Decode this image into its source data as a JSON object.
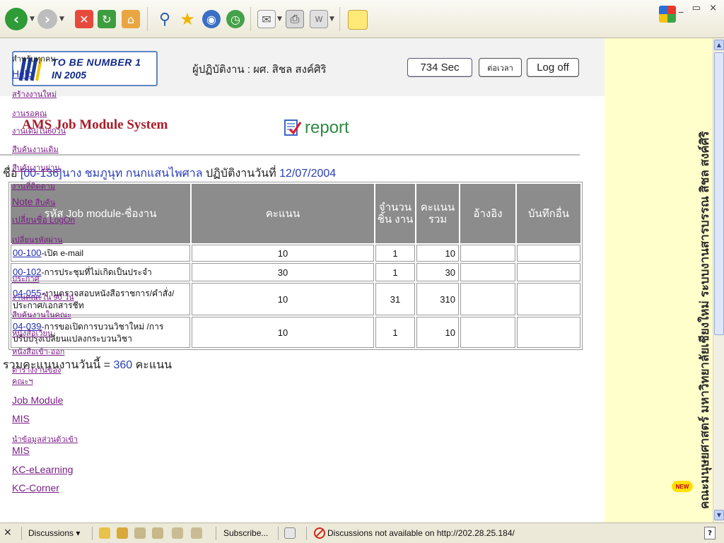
{
  "window": {
    "controls": "_ ▭ ×"
  },
  "header": {
    "logo_line1": "TO BE NUMBER 1",
    "logo_line2": "IN 2005",
    "operator_text": "ผู้ปฏิบัติงาน : ผศ. สิชล สงค์ศิริ",
    "timer_label": "734 Sec",
    "extend_label": "ต่อเวลา",
    "logoff_label": "Log off"
  },
  "main": {
    "system_title": "AMS Job Module System",
    "report_label": "report",
    "person_prefix": "ชื่อ ",
    "person_id_name": "[00-136]นาง ชมภูนุท กนกแสนไพศาล",
    "date_prefix": " ปฏิบัติงานวันที่ ",
    "date": "12/07/2004",
    "table": {
      "headers": {
        "job": "รหัส Job module-ชื่องาน",
        "score": "คะแนน",
        "count": "จำนวน ชิ้น งาน",
        "total": "คะแนน รวม",
        "ref": "อ้างอิง",
        "note": "บันทึกอื่น"
      },
      "rows": [
        {
          "code": "00-100",
          "name": "-เปิด e-mail",
          "score": "10",
          "count": "1",
          "total": "10"
        },
        {
          "code": "00-102",
          "name": "-การประชุมที่ไม่เกิดเป็นประจำ",
          "score": "30",
          "count": "1",
          "total": "30"
        },
        {
          "code": "04-055",
          "name": "-งานตรวจสอบหนังสือราชการ/คำสั่ง/ประกาศ/เอกสารชีท",
          "score": "10",
          "count": "31",
          "total": "310"
        },
        {
          "code": "04-039",
          "name": "-การขอเปิดการบวนวิชาใหม่ /การปรับปรุงเปลี่ยนแปลงกระบวนวิชา",
          "score": "10",
          "count": "1",
          "total": "10"
        }
      ]
    },
    "total_prefix": "รวมคะแนนงานวันนี้ = ",
    "total_value": "360",
    "total_suffix": " คะแนน"
  },
  "sidebar": {
    "heading": "สำหรับทุกคน",
    "help": "Help",
    "create_new": "สร้างงานใหม่",
    "pending": "งานรอคุณ",
    "old60": "งานเดิมใน60วัน",
    "search_old": "สืบค้นงานเดิม",
    "search_passed": "สืบค้นงานผ่าน",
    "tracked": "งานที่ติดตาม",
    "note_search_a": "Note",
    "note_search_b": " สืบค้น",
    "change_logon": "เปลี่ยนชื่อ LogOn",
    "change_password": "เปลี่ยนรหัสผ่าน",
    "announce": "ประกาศ",
    "faculty90": "งานคณะใน 90 วัน",
    "search_faculty": "สืบค้นงานในคณะ",
    "circular": "หนังสือเวียน",
    "inout": "หนังสือเข้า-ออก",
    "schedule_a": "ตารางงานของ",
    "schedule_b": "คณะฯ",
    "job_module": "Job Module",
    "mis": "MIS",
    "import_a": "นำข้อมูลส่วนตัวเข้า",
    "import_b": "MIS",
    "kc_elearning": "KC-eLearning",
    "kc_corner": "KC-Corner",
    "new_badge": "NEW",
    "vertical_text": "คณะมนุษยศาสตร์ มหาวิทยาลัยเชียงใหม่ ระบบงานสารบรรณ สิชล สงค์ศิริ"
  },
  "discussion_bar": {
    "close": "×",
    "discussions": "Discussions ▾",
    "subscribe": "Subscribe...",
    "status": "Discussions not available on http://202.28.25.184/"
  },
  "colors": {
    "accent_title": "#a81d2a",
    "link_blue": "#1f2bb0",
    "report_green": "#2f8a42",
    "sidebar_bg": "#ffffcc",
    "table_header": "#8c8c8c"
  }
}
